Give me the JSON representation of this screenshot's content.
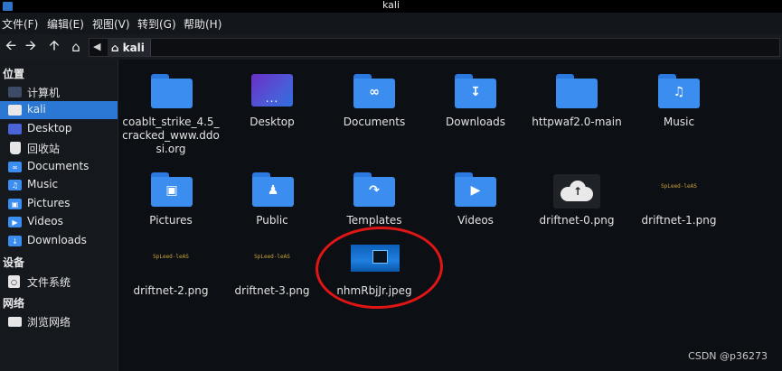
{
  "window": {
    "title": "kali"
  },
  "menu": [
    "文件(F)",
    "编辑(E)",
    "视图(V)",
    "转到(G)",
    "帮助(H)"
  ],
  "toolbar": {
    "breadcrumb": "kali"
  },
  "sidebar": {
    "places_header": "位置",
    "places": [
      {
        "label": "计算机",
        "icon": "computer-icon"
      },
      {
        "label": "kali",
        "icon": "home-icon",
        "active": true
      },
      {
        "label": "Desktop",
        "icon": "desktop-folder-icon"
      },
      {
        "label": "回收站",
        "icon": "trash-icon"
      },
      {
        "label": "Documents",
        "icon": "documents-folder-icon"
      },
      {
        "label": "Music",
        "icon": "music-folder-icon"
      },
      {
        "label": "Pictures",
        "icon": "pictures-folder-icon"
      },
      {
        "label": "Videos",
        "icon": "videos-folder-icon"
      },
      {
        "label": "Downloads",
        "icon": "downloads-folder-icon"
      }
    ],
    "devices_header": "设备",
    "devices": [
      {
        "label": "文件系统",
        "icon": "drive-icon"
      }
    ],
    "network_header": "网络",
    "network": [
      {
        "label": "浏览网络",
        "icon": "network-icon"
      }
    ]
  },
  "files": [
    {
      "name": "coablt_strike_4.5_cracked_www.ddosi.org",
      "lines": [
        "coablt_strike_4.5_",
        "cracked_www.ddo",
        "si.org"
      ],
      "type": "folder"
    },
    {
      "name": "Desktop",
      "type": "desktop"
    },
    {
      "name": "Documents",
      "type": "folder",
      "glyph": "link-icon"
    },
    {
      "name": "Downloads",
      "type": "folder",
      "glyph": "download-icon"
    },
    {
      "name": "httpwaf2.0-main",
      "type": "folder"
    },
    {
      "name": "Music",
      "type": "folder",
      "glyph": "music-icon"
    },
    {
      "name": "Pictures",
      "type": "folder",
      "glyph": "image-icon"
    },
    {
      "name": "Public",
      "type": "folder",
      "glyph": "people-icon"
    },
    {
      "name": "Templates",
      "type": "folder",
      "glyph": "template-icon"
    },
    {
      "name": "Videos",
      "type": "folder",
      "glyph": "video-icon"
    },
    {
      "name": "driftnet-0.png",
      "type": "image-cloud"
    },
    {
      "name": "driftnet-1.png",
      "type": "image-text",
      "thumb_text": "SpLeed-leAS"
    },
    {
      "name": "driftnet-2.png",
      "type": "image-text",
      "thumb_text": "SpLeed-leAS"
    },
    {
      "name": "driftnet-3.png",
      "type": "image-text",
      "thumb_text": "SpLeed-leAS"
    },
    {
      "name": "nhmRbjJr.jpeg",
      "type": "image-jpeg"
    }
  ],
  "watermark": "CSDN @p36273",
  "colors": {
    "accent": "#2a78d4",
    "folder": "#3b8ef0",
    "annotation": "#e01616"
  }
}
